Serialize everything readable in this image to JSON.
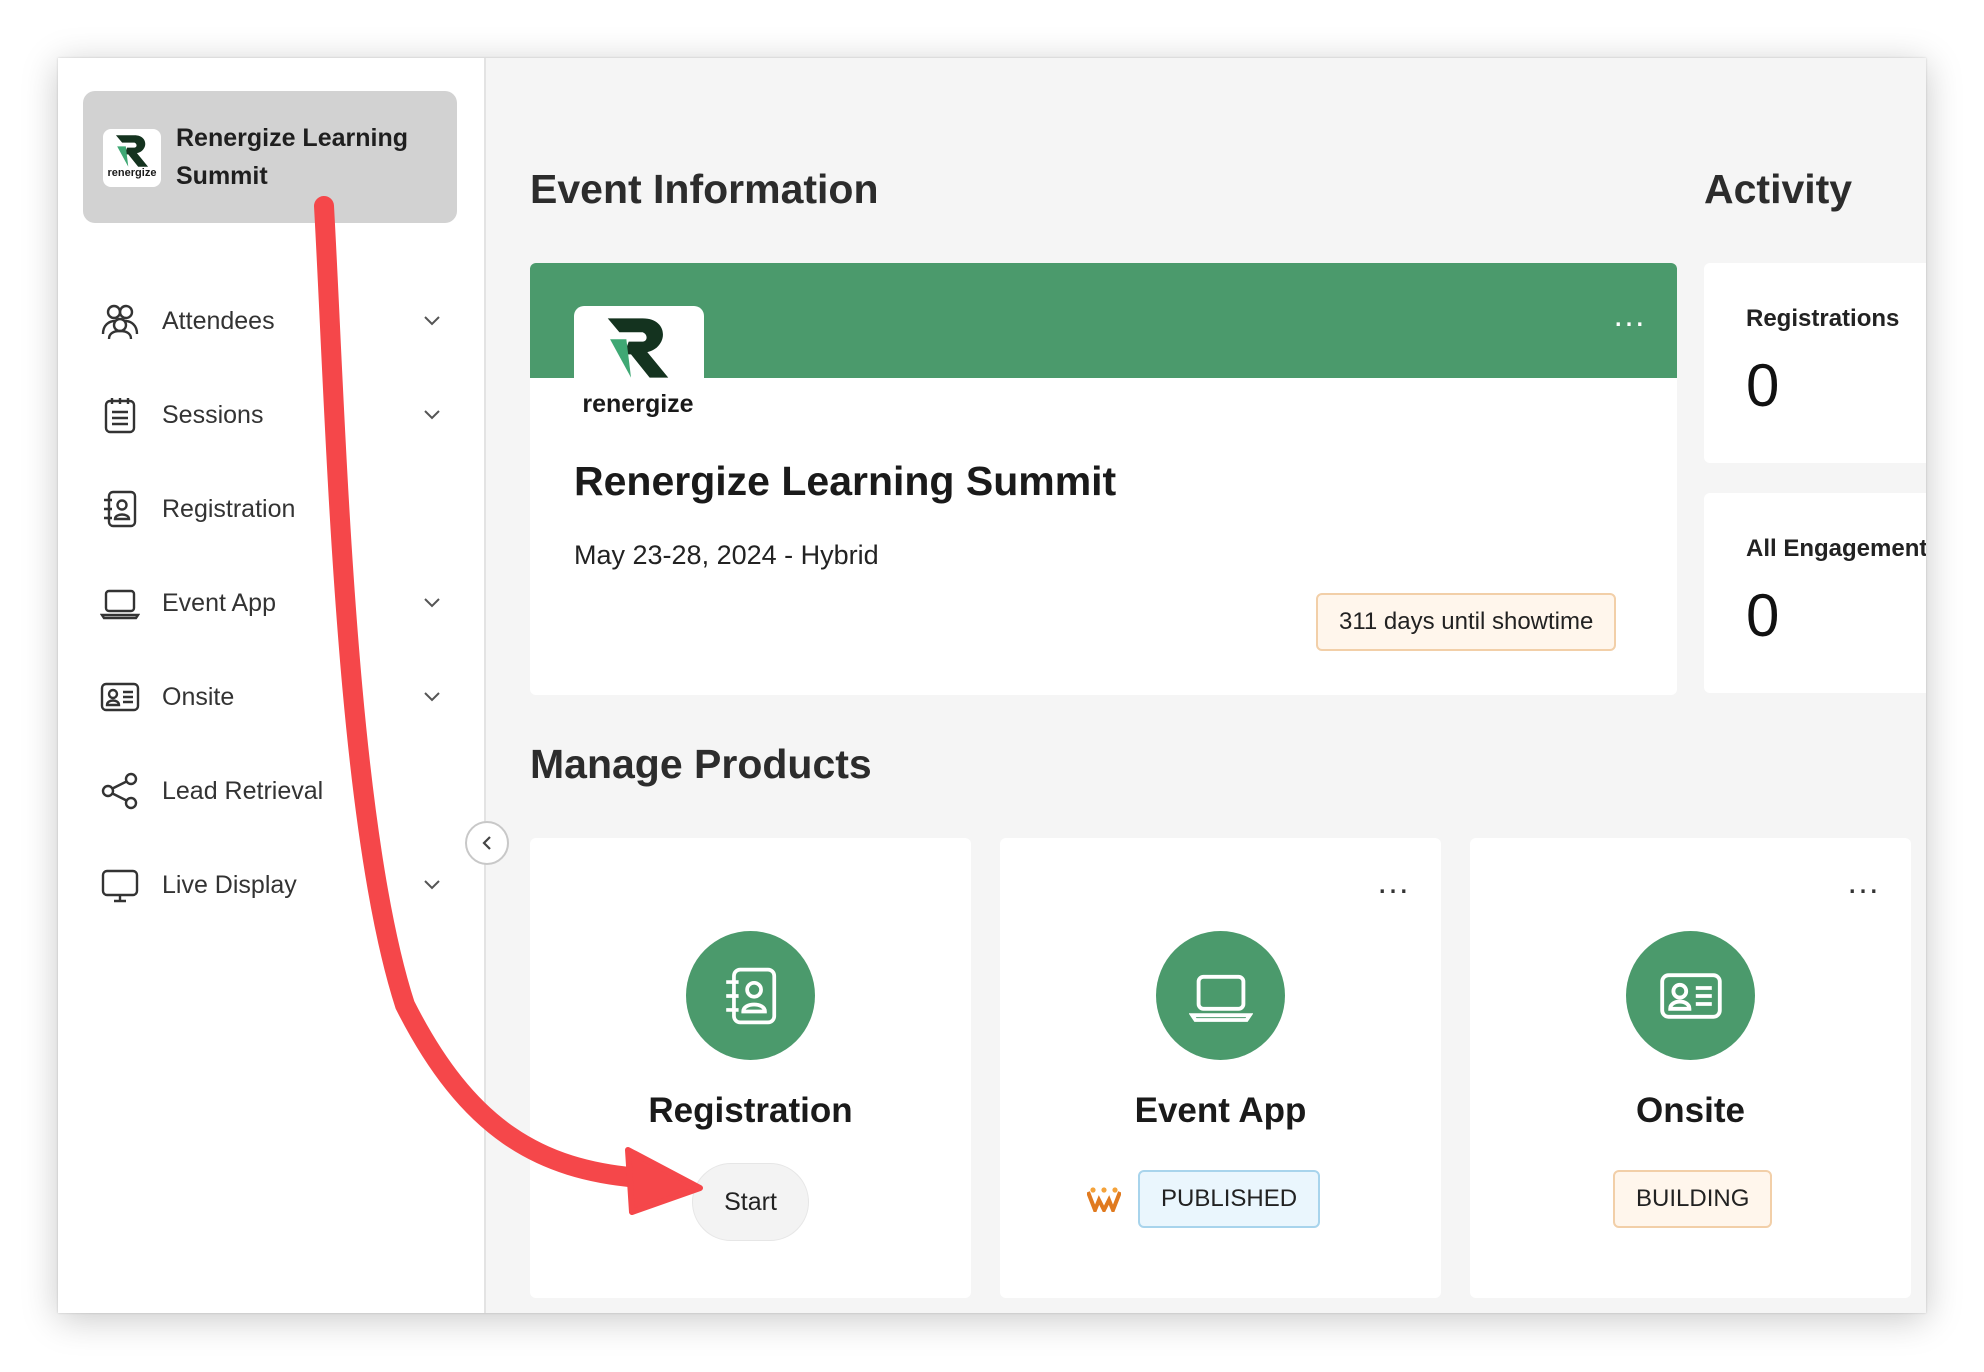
{
  "sidebar": {
    "event_title": "Renergize Learning Summit",
    "logo_word": "renergize",
    "items": [
      {
        "label": "Attendees",
        "icon": "people-icon",
        "expandable": true
      },
      {
        "label": "Sessions",
        "icon": "notepad-icon",
        "expandable": true
      },
      {
        "label": "Registration",
        "icon": "contact-book-icon",
        "expandable": false
      },
      {
        "label": "Event App",
        "icon": "laptop-icon",
        "expandable": true
      },
      {
        "label": "Onsite",
        "icon": "id-card-icon",
        "expandable": true
      },
      {
        "label": "Lead Retrieval",
        "icon": "share-icon",
        "expandable": false
      },
      {
        "label": "Live Display",
        "icon": "monitor-icon",
        "expandable": true
      }
    ]
  },
  "event_info": {
    "heading": "Event Information",
    "logo_word": "renergize",
    "name": "Renergize Learning Summit",
    "dates": "May 23-28, 2024 - Hybrid",
    "countdown": "311 days until showtime",
    "menu": "…"
  },
  "activity": {
    "heading": "Activity",
    "stats": [
      {
        "label": "Registrations",
        "value": "0"
      },
      {
        "label": "All Engagement",
        "value": "0"
      }
    ]
  },
  "manage_products": {
    "heading": "Manage Products",
    "products": [
      {
        "name": "Registration",
        "action": "Start",
        "icon": "contact-book-icon"
      },
      {
        "name": "Event App",
        "status": "PUBLISHED",
        "icon": "laptop-icon",
        "menu": "…"
      },
      {
        "name": "Onsite",
        "status": "BUILDING",
        "icon": "id-card-icon",
        "menu": "…"
      }
    ]
  },
  "colors": {
    "brand_green": "#4b9a6c",
    "annotation_arrow": "#f5474a",
    "published_border": "#a8d4ec",
    "building_border": "#f2cfa8"
  }
}
